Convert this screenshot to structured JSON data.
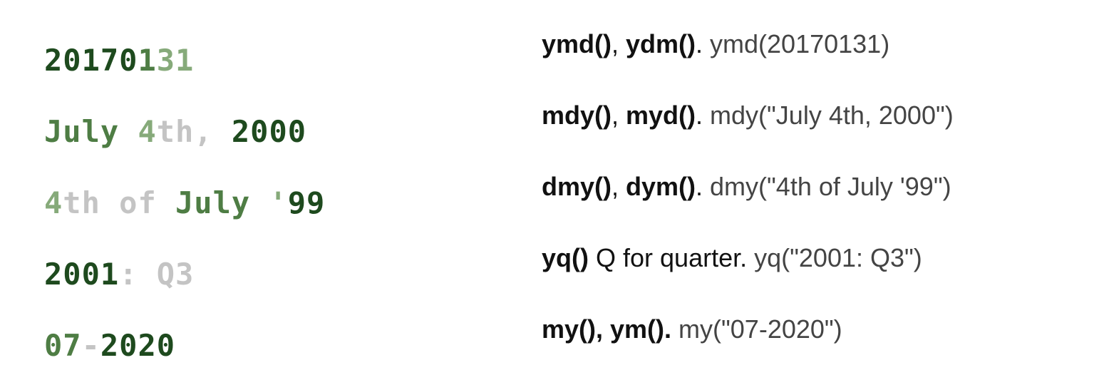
{
  "colors": {
    "dark_green": "#1e4a1e",
    "mid_green": "#4e7d44",
    "light_green": "#86aa7a",
    "gray": "#c4c4c4"
  },
  "date_examples": [
    {
      "segments": [
        {
          "text": "20170",
          "color": "#1e4a1e"
        },
        {
          "text": "1",
          "color": "#4e7d44"
        },
        {
          "text": "31",
          "color": "#86aa7a"
        }
      ]
    },
    {
      "segments": [
        {
          "text": "July ",
          "color": "#4e7d44"
        },
        {
          "text": "4",
          "color": "#86aa7a"
        },
        {
          "text": "th, ",
          "color": "#c4c4c4"
        },
        {
          "text": "2000",
          "color": "#1e4a1e"
        }
      ]
    },
    {
      "segments": [
        {
          "text": "4",
          "color": "#86aa7a"
        },
        {
          "text": "th of ",
          "color": "#c4c4c4"
        },
        {
          "text": "July ",
          "color": "#4e7d44"
        },
        {
          "text": "'",
          "color": "#86aa7a"
        },
        {
          "text": "99",
          "color": "#1e4a1e"
        }
      ]
    },
    {
      "segments": [
        {
          "text": "2001",
          "color": "#1e4a1e"
        },
        {
          "text": ": Q3",
          "color": "#c4c4c4"
        }
      ]
    },
    {
      "segments": [
        {
          "text": "07",
          "color": "#4e7d44"
        },
        {
          "text": "-",
          "color": "#c4c4c4"
        },
        {
          "text": "2020",
          "color": "#1e4a1e"
        }
      ]
    }
  ],
  "functions": [
    {
      "bold_a": "ymd()",
      "sep": ", ",
      "bold_b": "ydm()",
      "dot": ".",
      "plain": "",
      "example": " ymd(20170131)"
    },
    {
      "bold_a": "mdy()",
      "sep": ", ",
      "bold_b": "myd()",
      "dot": ".",
      "plain": "",
      "example": " mdy(\"July 4th, 2000\")"
    },
    {
      "bold_a": "dmy()",
      "sep": ", ",
      "bold_b": "dym()",
      "dot": ".",
      "plain": "",
      "example": " dmy(\"4th of July '99\")"
    },
    {
      "bold_a": "yq()",
      "sep": "",
      "bold_b": "",
      "dot": "",
      "plain": " Q for quarter.",
      "example": " yq(\"2001: Q3\")"
    },
    {
      "bold_a": "my(), ym().",
      "sep": "",
      "bold_b": "",
      "dot": "",
      "plain": "",
      "example": " my(\"07-2020\")"
    }
  ]
}
